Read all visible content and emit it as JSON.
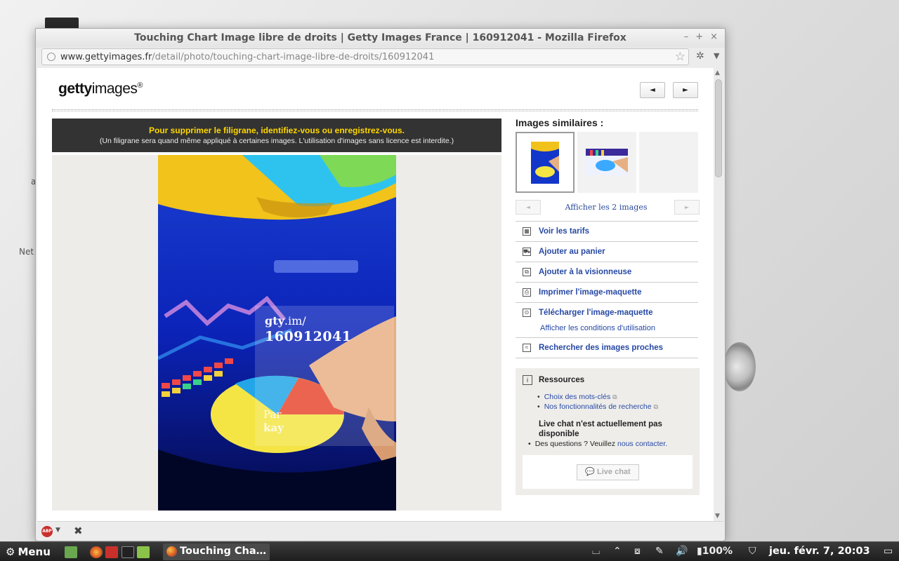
{
  "browser": {
    "window_title": "Touching Chart Image libre de droits | Getty Images France | 160912041 - Mozilla Firefox",
    "url_domain": "www.gettyimages.fr",
    "url_path": "/detail/photo/touching-chart-image-libre-de-droits/160912041",
    "controls": {
      "minimize": "–",
      "maximize": "+",
      "close": "×"
    }
  },
  "page": {
    "logo": {
      "bold": "getty",
      "rest": "images",
      "reg": "®"
    },
    "prev_label": "◄",
    "next_label": "►",
    "banner": {
      "line1": "Pour supprimer le filigrane, identifiez-vous ou enregistrez-vous.",
      "line2": "(Un filigrane sera quand même appliqué à certaines images. L'utilisation d'images sans licence est interdite.)"
    },
    "watermark": {
      "url_bold": "gty",
      "url_rest": ".im/",
      "id": "160912041",
      "by_label": "Par",
      "author": "kay"
    },
    "similar": {
      "title": "Images similaires :",
      "show_all": "Afficher les 2 images",
      "prev": "◄",
      "next": "►"
    },
    "actions": [
      {
        "label": "Voir les tarifs",
        "icon": "calculator-icon",
        "glyph": "▦"
      },
      {
        "label": "Ajouter au panier",
        "icon": "cart-icon",
        "glyph": "⛟"
      },
      {
        "label": "Ajouter à la visionneuse",
        "icon": "lightbox-icon",
        "glyph": "⧉"
      },
      {
        "label": "Imprimer l'image-maquette",
        "icon": "print-icon",
        "glyph": "⎙"
      },
      {
        "label": "Télécharger l'image-maquette",
        "icon": "download-icon",
        "glyph": "⊙",
        "sub": "Afficher les conditions d'utilisation"
      },
      {
        "label": "Rechercher des images proches",
        "icon": "similar-search-icon",
        "glyph": "≈"
      }
    ],
    "resources": {
      "title": "Ressources",
      "links": [
        "Choix des mots-clés",
        "Nos fonctionnalités de recherche"
      ],
      "chat_title": "Live chat n'est actuellement pas disponible",
      "question_prefix": "Des questions ? Veuillez ",
      "question_link": "nous contacter.",
      "chat_button": "Live chat"
    }
  },
  "desktop": {
    "label_1": "Net",
    "label_2": "a"
  },
  "taskbar": {
    "menu_label": "Menu",
    "task_label": "Touching Cha…",
    "battery": "100%",
    "clock": "jeu. févr.  7, 20:03"
  },
  "colors": {
    "link": "#2749a4",
    "banner_bg": "#333333",
    "banner_highlight": "#ffd700"
  }
}
